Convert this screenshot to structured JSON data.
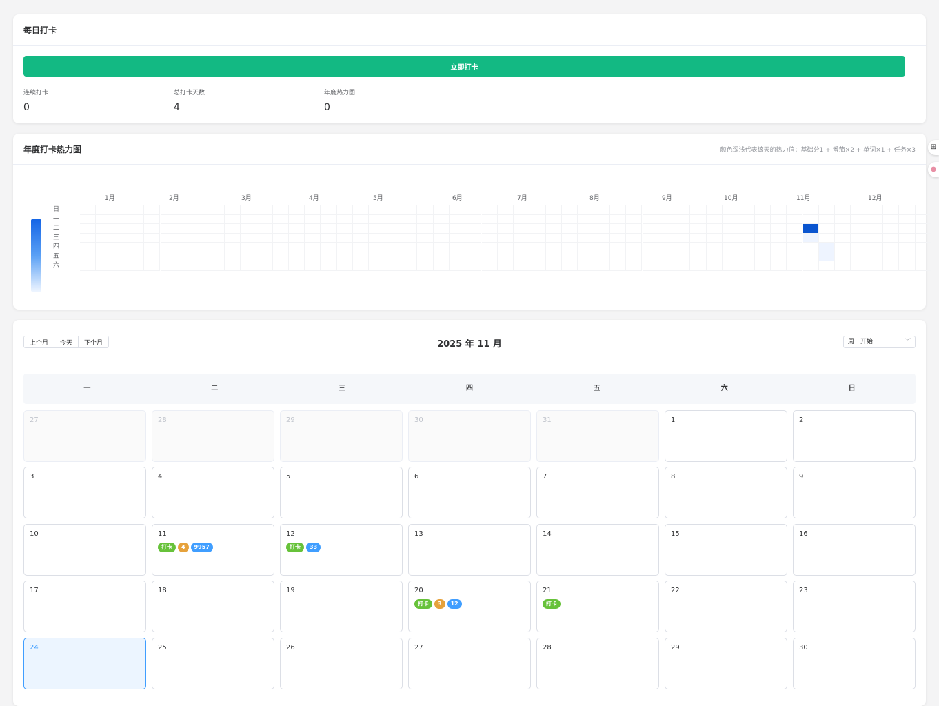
{
  "checkin": {
    "title": "每日打卡",
    "button_label": "立即打卡",
    "stats": [
      {
        "label": "连续打卡",
        "value": "0"
      },
      {
        "label": "总打卡天数",
        "value": "4"
      },
      {
        "label": "年度热力图",
        "value": "0"
      }
    ]
  },
  "heatmap": {
    "title": "年度打卡热力图",
    "note": "颜色深浅代表该天的热力值：基础分1 + 番茄×2 + 单词×1 + 任务×3",
    "months": [
      "1月",
      "2月",
      "3月",
      "4月",
      "5月",
      "6月",
      "7月",
      "8月",
      "9月",
      "10月",
      "11月",
      "12月"
    ],
    "weekdays": [
      "日",
      "一",
      "二",
      "三",
      "四",
      "五",
      "六"
    ],
    "legend_colors": [
      "#1565e6",
      "#eef5ff"
    ],
    "active_cells": [
      {
        "week": 45,
        "weekday": 2,
        "level": 1.0
      },
      {
        "week": 45,
        "weekday": 3,
        "level": 0.12
      },
      {
        "week": 46,
        "weekday": 4,
        "level": 0.08
      },
      {
        "week": 46,
        "weekday": 5,
        "level": 0.08
      }
    ]
  },
  "calendar": {
    "prev_label": "上个月",
    "today_label": "今天",
    "next_label": "下个月",
    "title": "2025 年 11 月",
    "week_start_select": "周一开始",
    "week_header": [
      "一",
      "二",
      "三",
      "四",
      "五",
      "六",
      "日"
    ],
    "days": [
      {
        "num": "27",
        "other": true
      },
      {
        "num": "28",
        "other": true
      },
      {
        "num": "29",
        "other": true
      },
      {
        "num": "30",
        "other": true
      },
      {
        "num": "31",
        "other": true
      },
      {
        "num": "1"
      },
      {
        "num": "2"
      },
      {
        "num": "3"
      },
      {
        "num": "4"
      },
      {
        "num": "5"
      },
      {
        "num": "6"
      },
      {
        "num": "7"
      },
      {
        "num": "8"
      },
      {
        "num": "9"
      },
      {
        "num": "10"
      },
      {
        "num": "11",
        "badges": [
          {
            "text": "打卡",
            "color": "green"
          },
          {
            "text": "4",
            "color": "orange"
          },
          {
            "text": "9957",
            "color": "blue"
          }
        ]
      },
      {
        "num": "12",
        "badges": [
          {
            "text": "打卡",
            "color": "green"
          },
          {
            "text": "33",
            "color": "blue"
          }
        ]
      },
      {
        "num": "13"
      },
      {
        "num": "14"
      },
      {
        "num": "15"
      },
      {
        "num": "16"
      },
      {
        "num": "17"
      },
      {
        "num": "18"
      },
      {
        "num": "19"
      },
      {
        "num": "20",
        "badges": [
          {
            "text": "打卡",
            "color": "green"
          },
          {
            "text": "3",
            "color": "orange"
          },
          {
            "text": "12",
            "color": "blue"
          }
        ]
      },
      {
        "num": "21",
        "badges": [
          {
            "text": "打卡",
            "color": "green"
          }
        ]
      },
      {
        "num": "22"
      },
      {
        "num": "23"
      },
      {
        "num": "24",
        "today": true
      },
      {
        "num": "25"
      },
      {
        "num": "26"
      },
      {
        "num": "27"
      },
      {
        "num": "28"
      },
      {
        "num": "29"
      },
      {
        "num": "30"
      }
    ]
  },
  "side_icons": [
    "grid-icon",
    "avatar-icon"
  ]
}
